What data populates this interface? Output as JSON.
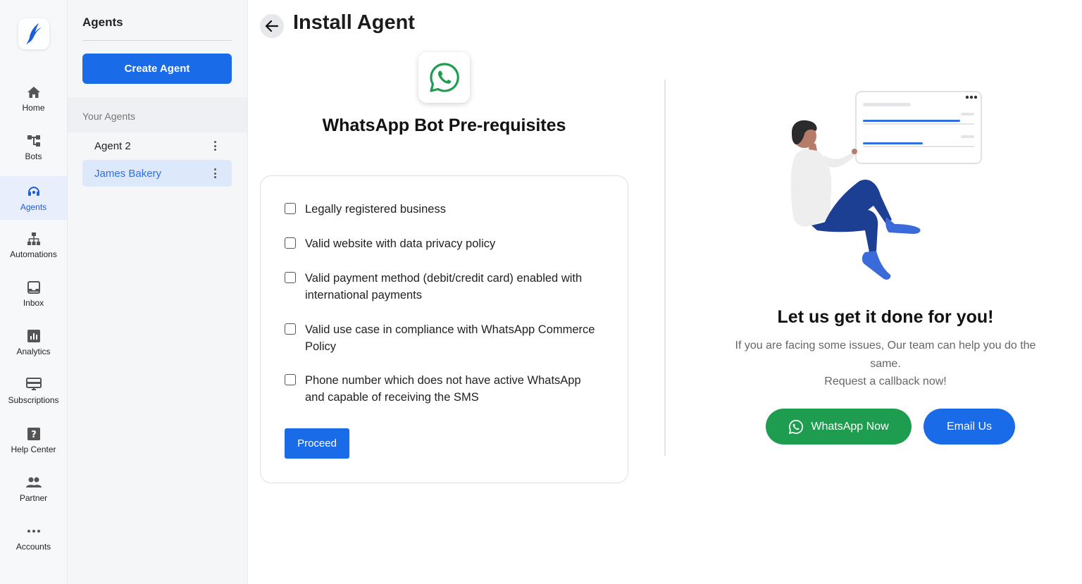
{
  "nav": {
    "items": [
      {
        "label": "Home",
        "icon": "home-icon"
      },
      {
        "label": "Bots",
        "icon": "bots-icon"
      },
      {
        "label": "Agents",
        "icon": "headset-icon",
        "active": true
      },
      {
        "label": "Automations",
        "icon": "sitemap-icon"
      },
      {
        "label": "Inbox",
        "icon": "inbox-icon"
      },
      {
        "label": "Analytics",
        "icon": "analytics-icon"
      },
      {
        "label": "Subscriptions",
        "icon": "subscriptions-icon"
      },
      {
        "label": "Help Center",
        "icon": "help-icon"
      },
      {
        "label": "Partner",
        "icon": "partner-icon"
      },
      {
        "label": "Accounts",
        "icon": "more-icon"
      }
    ]
  },
  "panel": {
    "title": "Agents",
    "create_label": "Create Agent",
    "section_label": "Your Agents",
    "agents": [
      {
        "name": "Agent 2"
      },
      {
        "name": "James Bakery",
        "selected": true
      }
    ]
  },
  "main": {
    "title": "Install Agent",
    "prereq_title": "WhatsApp Bot Pre-requisites",
    "checklist": [
      {
        "text": "Legally registered business",
        "checked": false
      },
      {
        "text": "Valid website with data privacy policy",
        "checked": false
      },
      {
        "text": "Valid payment method (debit/credit card) enabled with international payments",
        "checked": false
      },
      {
        "text": "Valid use case in compliance with WhatsApp Commerce Policy",
        "checked": false
      },
      {
        "text": "Phone number which does not have active WhatsApp and capable of receiving the SMS",
        "checked": false
      }
    ],
    "proceed_label": "Proceed"
  },
  "help": {
    "title": "Let us get it done for you!",
    "text": "If you are facing some issues, Our team can help you do the same.",
    "text2": "Request a callback now!",
    "whatsapp_label": "WhatsApp Now",
    "email_label": "Email Us"
  },
  "colors": {
    "primary": "#1a6be8",
    "whatsapp_green": "#1e9c4f",
    "active_bg": "#e8eefb",
    "selected_agent_bg": "#dde8fb"
  }
}
